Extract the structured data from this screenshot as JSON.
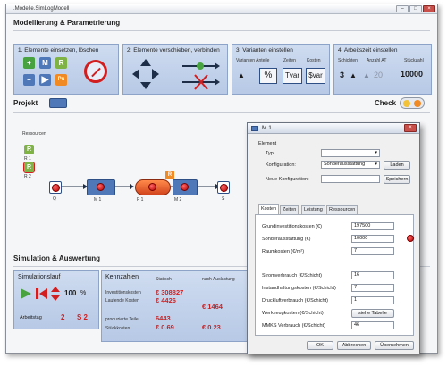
{
  "window": {
    "title": ".Modelle.SimLogModell"
  },
  "sections": {
    "modelling": "Modellierung & Parametrierung",
    "project": "Projekt",
    "check": "Check",
    "simulation": "Simulation & Auswertung"
  },
  "tools": {
    "insert": {
      "title": "1. Elemente einsetzen, löschen",
      "m": "M",
      "r": "R",
      "pu": "Pu"
    },
    "move": {
      "title": "2. Elemente verschieben, verbinden"
    },
    "variants": {
      "title": "3. Varianten einstellen",
      "col1": "Varianten Anteile",
      "col2": "Zeiten",
      "col3": "Kosten",
      "pct": "%",
      "tvar": "Tvar",
      "svar": "$var"
    },
    "worktime": {
      "title": "4. Arbeitszeit einstellen",
      "col1": "Schichten",
      "col2": "Anzahl AT",
      "col3": "Stückzahl",
      "shifts": "3",
      "days": "20",
      "count": "10000"
    }
  },
  "canvas": {
    "resources_label": "Ressourcen",
    "r1": "R 1",
    "r2": "R 2",
    "q": "Q",
    "m1": "M 1",
    "p1": "P 1",
    "m2": "M 2",
    "s": "S",
    "r_badge": "R",
    "r3": "R 3"
  },
  "simulation": {
    "run_title": "Simulationslauf",
    "percent": "100",
    "percent_unit": "%",
    "day_label": "Arbeitstag",
    "day_value": "2",
    "shift_value": "S 2",
    "kpi": {
      "title": "Kennzahlen",
      "col_static": "Statisch",
      "col_after": "nach Auslastung",
      "invest_label": "Investitionskosten",
      "invest_static": "€ 308827",
      "running_label": "Laufende Kosten",
      "running_static": "€ 4426",
      "running_after": "€ 1464",
      "produced_label": "produzierte Teile",
      "produced_static": "6443",
      "unit_label": "Stückkosten",
      "unit_static": "€ 0.69",
      "unit_after": "€ 0.23"
    }
  },
  "dialog": {
    "title": "M 1",
    "group": "Element",
    "typ_label": "Typ:",
    "typ_value": "",
    "konfig_label": "Konfiguration:",
    "konfig_value": "Sonderausstattung I",
    "laden": "Laden",
    "neue_label": "Neue Konfiguration:",
    "neue_value": "",
    "speichern": "Speichern",
    "tabs": [
      "Kosten",
      "Zeiten",
      "Leistung",
      "Ressourcen"
    ],
    "fields": [
      {
        "label": "Grundinvestitionskosten (€)",
        "value": "197500"
      },
      {
        "label": "Sonderausstattung (€)",
        "value": "10000"
      },
      {
        "label": "Raumkosten (€/m²)",
        "value": "7"
      },
      {
        "label": "Stromverbrauch (€/Schicht)",
        "value": "16"
      },
      {
        "label": "Instandhaltungskosten (€/Schicht)",
        "value": "7"
      },
      {
        "label": "Druckluftverbrauch (€/Schicht)",
        "value": "1"
      },
      {
        "label": "Werkzeugkosten (€/Schicht)",
        "value": ""
      },
      {
        "label": "MMKS Verbrauch (€/Schicht)",
        "value": "46"
      }
    ],
    "table_button": "siehe Tabelle",
    "ok": "OK",
    "cancel": "Abbrechen",
    "apply": "Übernehmen"
  },
  "colors": {
    "accent_blue": "#4f78b8",
    "panel_blue": "#c2d2eb",
    "red": "#d21e1e",
    "green": "#48a23f",
    "orange": "#f08a24"
  }
}
